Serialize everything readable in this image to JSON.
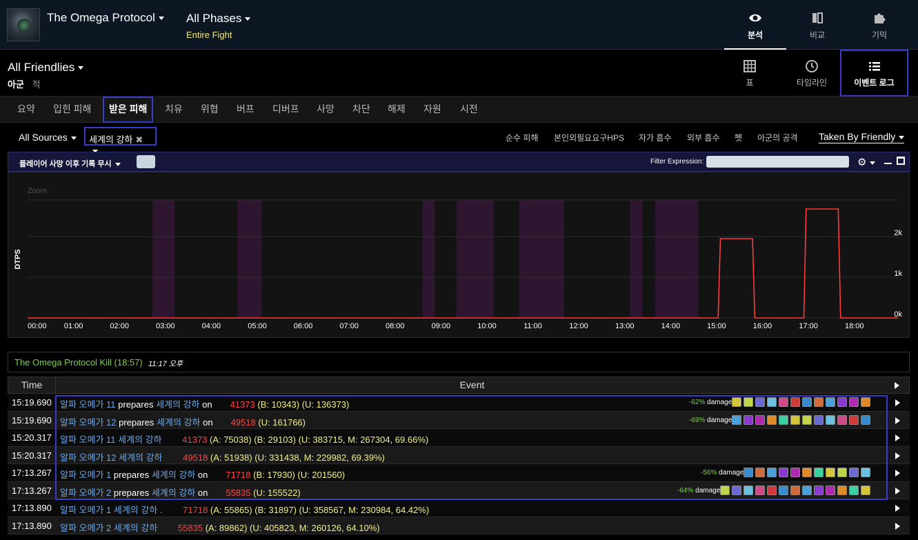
{
  "topbar": {
    "fight_title": "The Omega Protocol",
    "phase_title": "All Phases",
    "phase_sub": "Entire Fight",
    "tabs": [
      {
        "label": "분석",
        "icon": "eye-icon"
      },
      {
        "label": "비교",
        "icon": "compare-icon"
      },
      {
        "label": "기믹",
        "icon": "puzzle-icon"
      }
    ]
  },
  "row2": {
    "friendlies": "All Friendlies",
    "ally": "아군",
    "enemy": "적",
    "views": [
      {
        "label": "표",
        "icon": "table-icon"
      },
      {
        "label": "타임라인",
        "icon": "clock-icon"
      },
      {
        "label": "이벤트 로그",
        "icon": "list-icon"
      }
    ]
  },
  "subtabs": [
    "요약",
    "입힌 피해",
    "받은 피해",
    "치유",
    "위협",
    "버프",
    "디버프",
    "사망",
    "차단",
    "해제",
    "자원",
    "시전"
  ],
  "filters": {
    "sources": "All Sources",
    "ability": "세계의 강하",
    "options": [
      "순수 피해",
      "본인외필요요구HPS",
      "자가 흡수",
      "외부 흡수",
      "펫",
      "아군의 공격"
    ],
    "taken_by": "Taken By Friendly"
  },
  "toolbar": {
    "ignore_deaths": "플레이어 사망 이후 기록 무시",
    "filter_label": "Filter Expression:",
    "filter_value": ""
  },
  "chart_data": {
    "type": "line",
    "zoom_label": "Zoom",
    "ylabel": "DTPS",
    "x_ticks": [
      "00:00",
      "01:00",
      "02:00",
      "03:00",
      "04:00",
      "05:00",
      "06:00",
      "07:00",
      "08:00",
      "09:00",
      "10:00",
      "11:00",
      "12:00",
      "13:00",
      "14:00",
      "15:00",
      "16:00",
      "17:00",
      "18:00"
    ],
    "y_ticks": [
      "0k",
      "1k",
      "2k"
    ],
    "ylim": [
      0,
      2900
    ],
    "xlim_seconds": [
      0,
      1137
    ],
    "series": [
      {
        "color": "#ff3b3b",
        "points": [
          [
            0,
            0
          ],
          [
            902,
            0
          ],
          [
            905,
            1950
          ],
          [
            947,
            1950
          ],
          [
            950,
            0
          ],
          [
            1014,
            0
          ],
          [
            1017,
            2680
          ],
          [
            1059,
            2680
          ],
          [
            1062,
            0
          ],
          [
            1137,
            0
          ]
        ]
      }
    ],
    "phase_bands_seconds": [
      [
        163,
        192
      ],
      [
        274,
        306
      ],
      [
        516,
        532
      ],
      [
        560,
        609
      ],
      [
        642,
        701
      ],
      [
        787,
        803
      ],
      [
        820,
        876
      ]
    ],
    "grid": true
  },
  "kill": {
    "name": "The Omega Protocol Kill (18:57)",
    "time": "11:17 오후"
  },
  "table": {
    "headers": {
      "time": "Time",
      "event": "Event"
    },
    "rows": [
      {
        "time": "15:19.690",
        "src": "알파 오메가 11",
        "verb": "prepares",
        "ability": "세계의 강하",
        "on": "on",
        "amount": "41373",
        "rest_y": " (B: 10343) (U: 136373)",
        "rest_w": "",
        "pct": "-62%",
        "buffs": 12
      },
      {
        "time": "15:19.690",
        "src": "알파 오메가 12",
        "verb": "prepares",
        "ability": "세계의 강하",
        "on": "on",
        "amount": "49518",
        "rest_y": " (U: 161766)",
        "rest_w": "",
        "pct": "-69%",
        "buffs": 12
      },
      {
        "time": "15:20.317",
        "src": "알파 오메가 11",
        "verb": "",
        "ability": "세계의 강하",
        "on": "",
        "amount": "41373",
        "rest_y": " (A: 75038) (B: 29103) (U: 383715, M: 267304, 69.66%)",
        "rest_w": "",
        "pct": "",
        "buffs": 0
      },
      {
        "time": "15:20.317",
        "src": "알파 오메가 12",
        "verb": "",
        "ability": "세계의 강하",
        "on": "",
        "amount": "49518",
        "rest_y": " (A: 51938) (U: 331438, M: 229982, 69.39%)",
        "rest_w": "",
        "pct": "",
        "buffs": 0
      },
      {
        "time": "17:13.267",
        "src": "알파 오메가 1",
        "verb": "prepares",
        "ability": "세계의 강하",
        "on": "on",
        "amount": "71718",
        "rest_y": " (B: 17930) (U: 201560)",
        "rest_w": "",
        "pct": "-56%",
        "buffs": 11
      },
      {
        "time": "17:13.267",
        "src": "알파 오메가 2",
        "verb": "prepares",
        "ability": "세계의 강하",
        "on": "on",
        "amount": "55835",
        "rest_y": " (U: 155522)",
        "rest_w": "",
        "pct": "-64%",
        "buffs": 13
      },
      {
        "time": "17:13.890",
        "src": "알파 오메가 1",
        "verb": "",
        "ability": "세계의 강하 .",
        "on": "",
        "amount": "71718",
        "rest_y": " (A: 55865) (B: 31897) (U: 358567, M: 230984, 64.42%)",
        "rest_w": "",
        "pct": "",
        "buffs": 0
      },
      {
        "time": "17:13.890",
        "src": "알파 오메가 2",
        "verb": "",
        "ability": "세계의 강하",
        "on": "",
        "amount": "55835",
        "rest_y": " (A: 89862) (U: 405823, M: 260126, 64.10%)",
        "rest_w": "",
        "pct": "",
        "buffs": 0
      }
    ],
    "dmg_suffix": "damage"
  }
}
